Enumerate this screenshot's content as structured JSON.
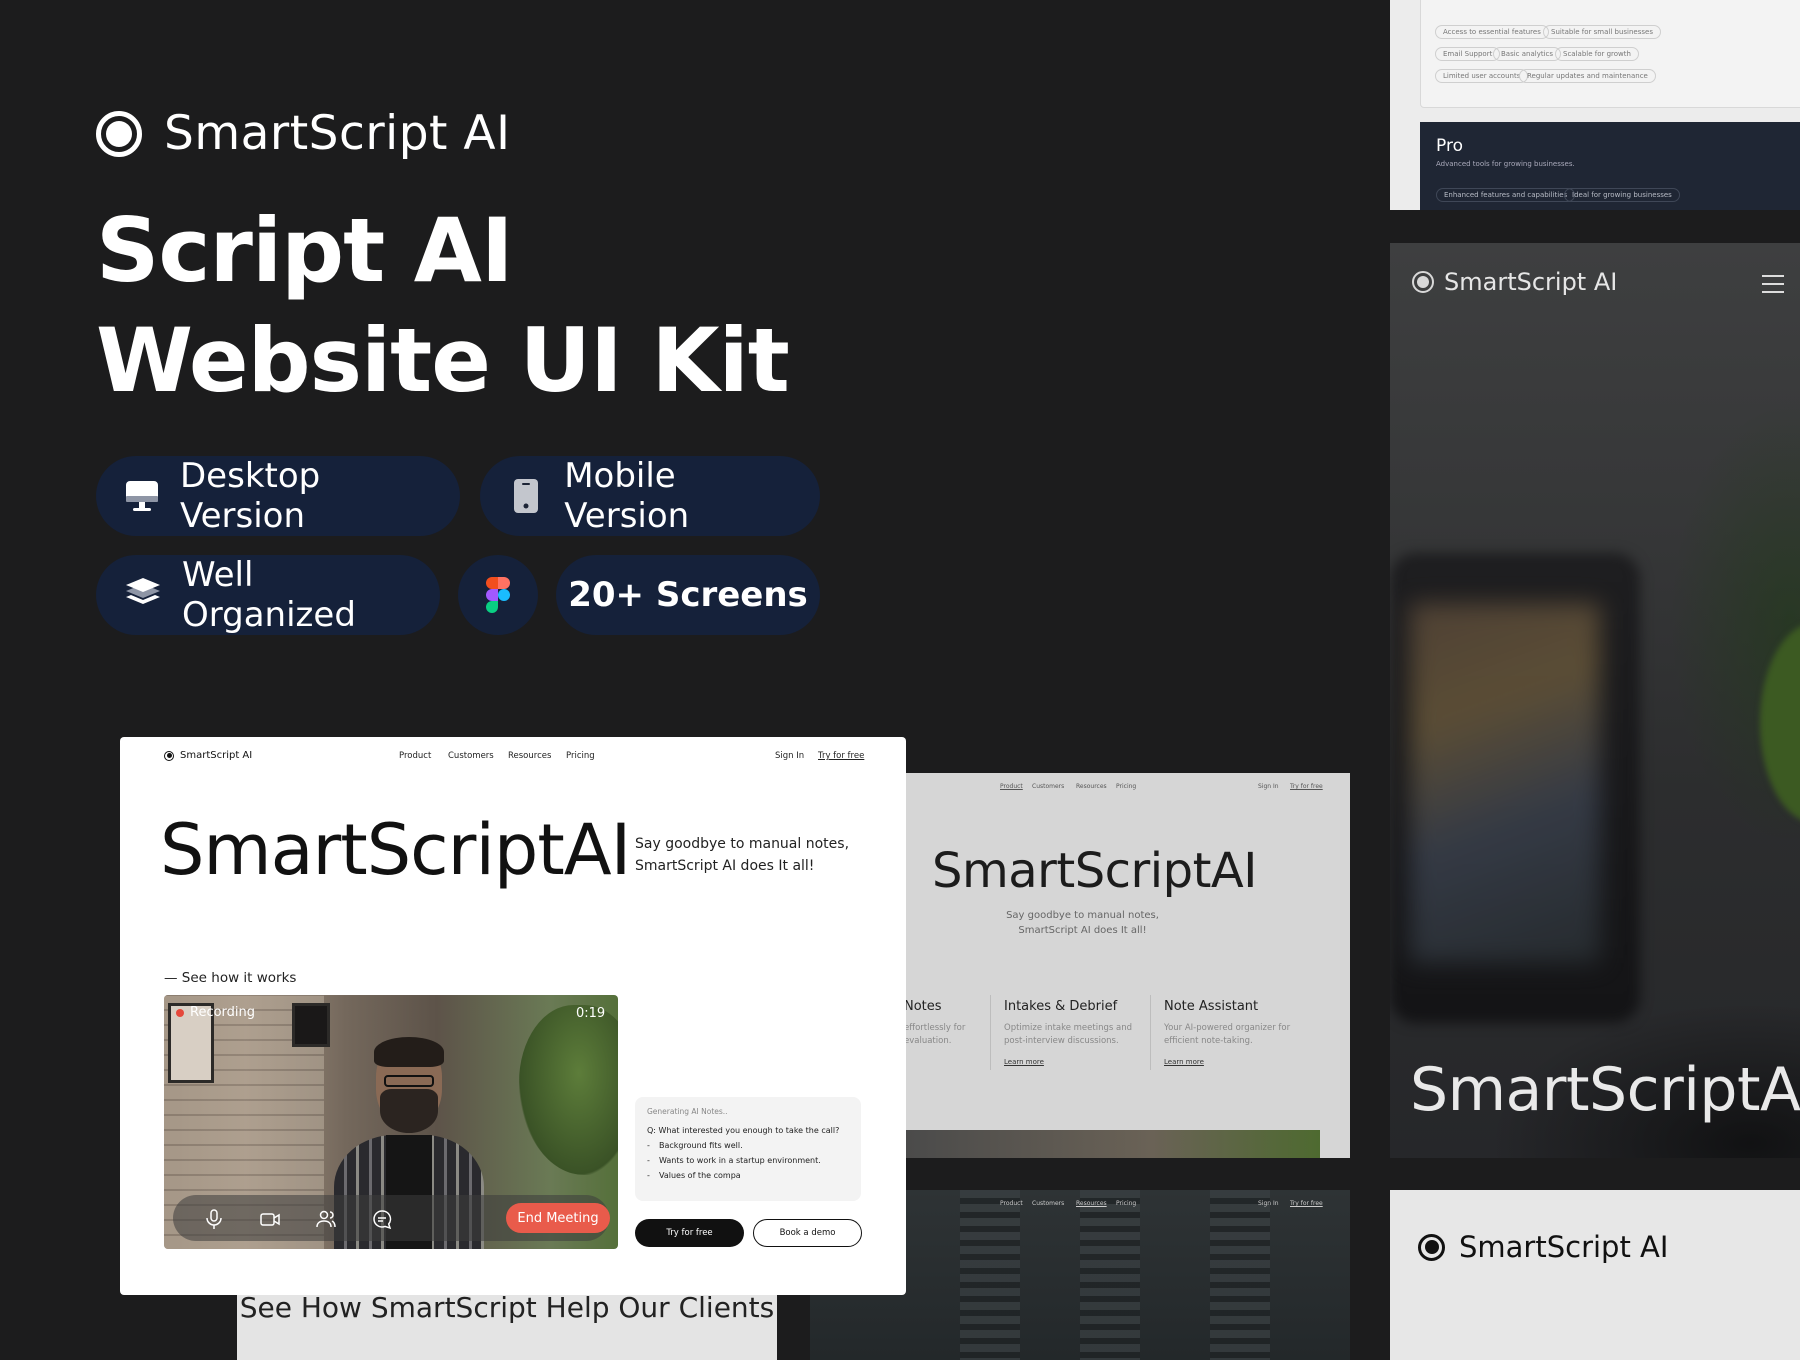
{
  "brand": {
    "name": "SmartScript AI"
  },
  "hero": {
    "line1": "Script AI",
    "line2": "Website UI Kit"
  },
  "pills": {
    "desktop": "Desktop Version",
    "mobile": "Mobile Version",
    "organized": "Well Organized",
    "screens": "20+ Screens"
  },
  "pricing": {
    "basic_tags": [
      "Access to essential features",
      "Suitable for small businesses",
      "Email Support",
      "Basic analytics",
      "Scalable for growth",
      "Limited user accounts",
      "Regular updates and maintenance"
    ],
    "pro_title": "Pro",
    "pro_sub": "Advanced tools for growing businesses.",
    "pro_price": "$",
    "pro_tags": [
      "Enhanced features and capabilities",
      "Ideal for growing businesses"
    ]
  },
  "mobile": {
    "brand": "SmartScript AI",
    "title": "SmartScriptAI",
    "brand2": "SmartScript AI"
  },
  "desktop": {
    "brand": "SmartScript AI",
    "nav": [
      "Product",
      "Customers",
      "Resources",
      "Pricing"
    ],
    "sign_in": "Sign In",
    "try_free": "Try for free",
    "title": "SmartScriptAI",
    "subtitle": "Say goodbye to manual notes, SmartScript AI does It all!",
    "see_how": "— See how it works",
    "recording": "Recording",
    "timer": "0:19",
    "end_meeting": "End Meeting",
    "notes": {
      "header": "Generating AI Notes..",
      "question": "Q: What interested you enough to take the call?",
      "bullets": [
        "Background fits well.",
        "Wants to work in a startup environment.",
        "Values of the compa"
      ]
    },
    "btn_try": "Try for free",
    "btn_demo": "Book a demo"
  },
  "grey_screen": {
    "nav": [
      "Product",
      "Customers",
      "Resources",
      "Pricing"
    ],
    "sign_in": "Sign In",
    "try_free": "Try for free",
    "title": "SmartScriptAI",
    "subtitle": "Say goodbye to manual notes, SmartScript AI does It all!",
    "features": [
      {
        "title": "Notes",
        "desc": "effortlessly for evaluation.",
        "link": ""
      },
      {
        "title": "Intakes & Debrief",
        "desc": "Optimize intake meetings and post-interview discussions.",
        "link": "Learn more"
      },
      {
        "title": "Note Assistant",
        "desc": "Your AI-powered organizer for efficient note-taking.",
        "link": "Learn more"
      }
    ]
  },
  "dark_screen": {
    "nav": [
      "Product",
      "Customers",
      "Resources",
      "Pricing"
    ],
    "sign_in": "Sign In",
    "try_free": "Try for free"
  },
  "clients": {
    "title": "See How SmartScript Help Our Clients"
  }
}
